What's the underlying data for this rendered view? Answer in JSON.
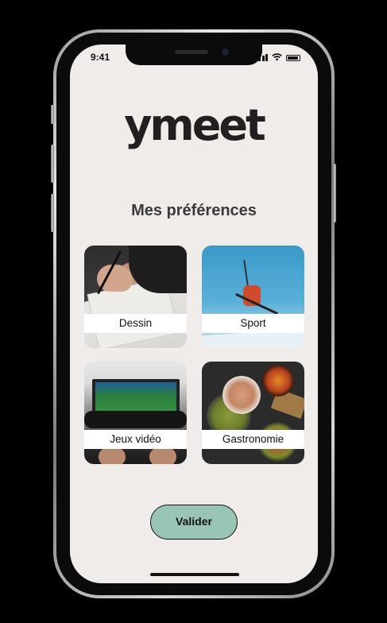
{
  "status_bar": {
    "time": "9:41"
  },
  "app": {
    "logo_text": "ymeet",
    "title": "Mes préférences"
  },
  "preferences": [
    {
      "label": "Dessin",
      "image": "drawing-photo"
    },
    {
      "label": "Sport",
      "image": "skiing-photo"
    },
    {
      "label": "Jeux vidéo",
      "image": "video-game-photo"
    },
    {
      "label": "Gastronomie",
      "image": "food-photo"
    }
  ],
  "actions": {
    "validate_label": "Valider"
  },
  "colors": {
    "screen_background": "#f0ecea",
    "button_accent": "#98c5b6",
    "text_dark": "#3a3a3a"
  },
  "icons": [
    "signal-icon",
    "wifi-icon",
    "battery-icon"
  ]
}
